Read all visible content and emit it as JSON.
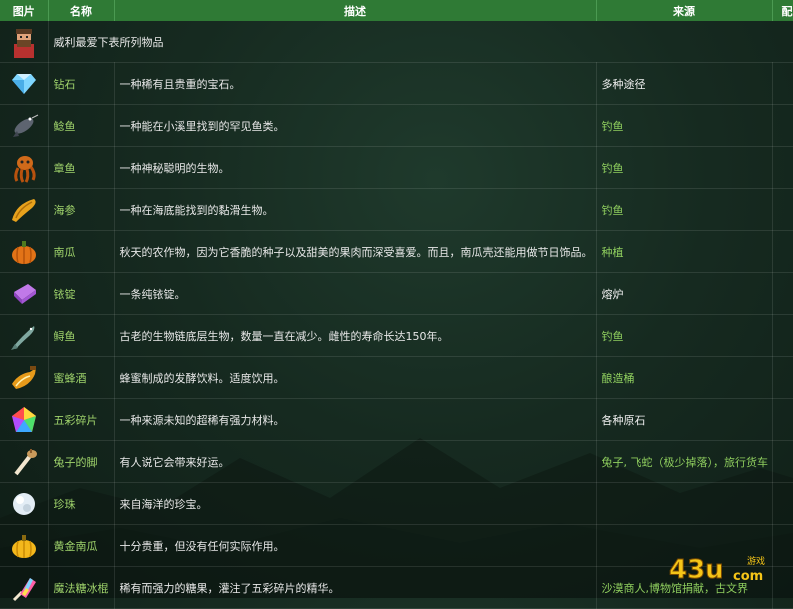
{
  "headers": {
    "pic": "图片",
    "name": "名称",
    "desc": "描述",
    "source": "来源",
    "recipe": "配方"
  },
  "intro": "威利最爱下表所列物品",
  "rows": [
    {
      "name": "钻石",
      "desc": "一种稀有且贵重的宝石。",
      "source": "多种途径",
      "source_style": "white",
      "icon": "diamond-icon"
    },
    {
      "name": "鲶鱼",
      "desc": "一种能在小溪里找到的罕见鱼类。",
      "source": "钓鱼",
      "source_style": "green",
      "icon": "catfish-icon"
    },
    {
      "name": "章鱼",
      "desc": "一种神秘聪明的生物。",
      "source": "钓鱼",
      "source_style": "green",
      "icon": "octopus-icon"
    },
    {
      "name": "海参",
      "desc": "一种在海底能找到的黏滑生物。",
      "source": "钓鱼",
      "source_style": "green",
      "icon": "sea-cucumber-icon"
    },
    {
      "name": "南瓜",
      "desc": "秋天的农作物，因为它香脆的种子以及甜美的果肉而深受喜爱。而且，南瓜壳还能用做节日饰品。",
      "source": "种植",
      "source_style": "green",
      "icon": "pumpkin-icon"
    },
    {
      "name": "铱锭",
      "desc": "一条纯铱锭。",
      "source": "熔炉",
      "source_style": "white",
      "icon": "iridium-bar-icon"
    },
    {
      "name": "鲟鱼",
      "desc": "古老的生物链底层生物，数量一直在减少。雌性的寿命长达150年。",
      "source": "钓鱼",
      "source_style": "green",
      "icon": "sturgeon-icon"
    },
    {
      "name": "蜜蜂酒",
      "desc": "蜂蜜制成的发酵饮料。适度饮用。",
      "source": "酿造桶",
      "source_style": "green",
      "icon": "mead-icon"
    },
    {
      "name": "五彩碎片",
      "desc": "一种来源未知的超稀有强力材料。",
      "source": "各种原石",
      "source_style": "white",
      "icon": "prismatic-shard-icon"
    },
    {
      "name": "兔子的脚",
      "desc": "有人说它会带来好运。",
      "source": "兔子, 飞蛇（极少掉落），旅行货车",
      "source_style": "green",
      "icon": "rabbit-foot-icon"
    },
    {
      "name": "珍珠",
      "desc": "来自海洋的珍宝。",
      "source": "",
      "source_style": "white",
      "icon": "pearl-icon"
    },
    {
      "name": "黄金南瓜",
      "desc": "十分贵重，但没有任何实际作用。",
      "source": "",
      "source_style": "white",
      "icon": "golden-pumpkin-icon"
    },
    {
      "name": "魔法糖冰棍",
      "desc": "稀有而强力的糖果，灌注了五彩碎片的精华。",
      "source": "沙漠商人,博物馆捐献，古文界",
      "source_style": "green",
      "icon": "magic-rock-candy-icon"
    }
  ],
  "watermark": {
    "brand": "43u",
    "suffix": "com",
    "sub": "游戏"
  }
}
